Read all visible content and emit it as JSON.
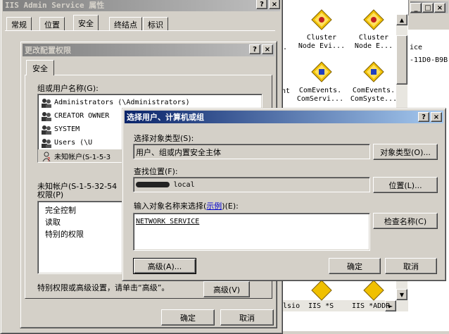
{
  "bg_window": {
    "right_header": "ice",
    "right_sub": "-11D0-B9B",
    "icons": [
      {
        "line1": "Cluster",
        "line2": "Node Evi..."
      },
      {
        "line1": "Cluster",
        "line2": "Node E..."
      },
      {
        "line1": "ComEvents.",
        "line2": "ComServi..."
      },
      {
        "line1": "ComEvents.",
        "line2": "ComSyste..."
      }
    ],
    "left_partial_1": ".",
    "left_partial_2": "nt",
    "bottom_texts": [
      "Clsio",
      "IIS *S",
      "IIS *ADDR"
    ]
  },
  "iis_props": {
    "title": "IIS Admin Service 属性",
    "help": "?",
    "close": "×",
    "tabs": [
      "常规",
      "位置",
      "安全",
      "终结点",
      "标识"
    ]
  },
  "change_perm": {
    "title": "更改配置权限",
    "help": "?",
    "close": "×",
    "tab": "安全",
    "group_label": "组或用户名称(G):",
    "users": [
      {
        "name": "Administrators (\\Administrators)"
      },
      {
        "name": "CREATOR OWNER"
      },
      {
        "name": "SYSTEM"
      },
      {
        "name": "Users (\\U"
      },
      {
        "name": "未知帐户(S-1-5-3"
      }
    ],
    "perm_for_label": "未知帐户(S-1-5-32-54",
    "perm_label": "权限(P)",
    "permissions": [
      "完全控制",
      "读取",
      "特别的权限"
    ],
    "advanced_hint": "特别权限或高级设置，请单击“高级”。",
    "advanced_button": "高级(V)",
    "ok": "确定",
    "cancel": "取消"
  },
  "select_users": {
    "title": "选择用户、计算机或组",
    "help": "?",
    "close": "×",
    "object_type_label": "选择对象类型(S):",
    "object_type_value": "用户、组或内置安全主体",
    "object_type_button": "对象类型(O)...",
    "location_label": "查找位置(F):",
    "location_value": "local",
    "location_button": "位置(L)...",
    "names_label_prefix": "输入对象名称来选择(",
    "names_label_link": "示例",
    "names_label_suffix": ")(E):",
    "names_value": "NETWORK SERVICE",
    "check_names_button": "检查名称(C)",
    "advanced_button": "高级(A)...",
    "ok": "确定",
    "cancel": "取消"
  }
}
